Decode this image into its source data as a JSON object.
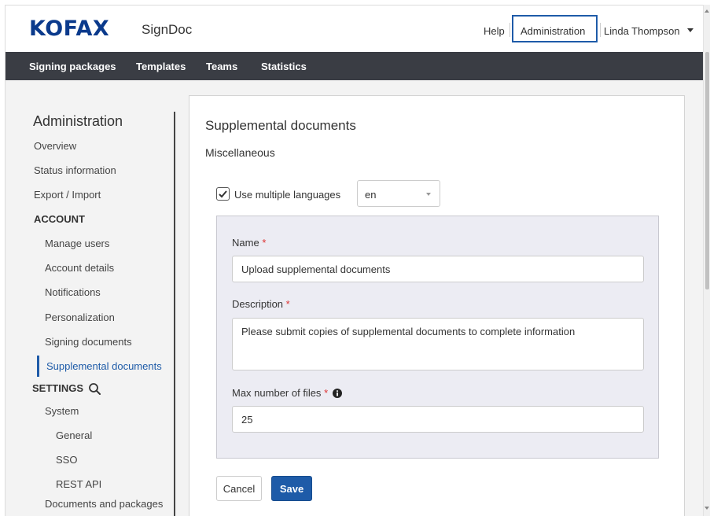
{
  "header": {
    "logo": "KOFAX",
    "product": "SignDoc",
    "help": "Help",
    "administration": "Administration",
    "user": "Linda Thompson"
  },
  "nav": {
    "items": [
      "Signing packages",
      "Templates",
      "Teams",
      "Statistics"
    ]
  },
  "sidebar": {
    "title": "Administration",
    "items": [
      "Overview",
      "Status information",
      "Export / Import",
      "ACCOUNT",
      "Manage users",
      "Account details",
      "Notifications",
      "Personalization",
      "Signing documents",
      "Supplemental documents",
      "SETTINGS",
      "System",
      "General",
      "SSO",
      "REST API",
      "Documents and packages"
    ],
    "active_item": "Supplemental documents"
  },
  "main": {
    "title": "Supplemental documents",
    "section": "Miscellaneous",
    "use_multiple_languages": {
      "label": "Use multiple languages",
      "checked": true
    },
    "language_select": "en",
    "form": {
      "name_label": "Name",
      "name_value": "Upload supplemental documents",
      "description_label": "Description",
      "description_value": "Please submit copies of supplemental documents to complete information",
      "max_files_label": "Max number of files",
      "max_files_value": "25",
      "required_marker": "*"
    },
    "buttons": {
      "cancel": "Cancel",
      "save": "Save"
    }
  },
  "colors": {
    "brand": "#0b3a8c",
    "accent": "#1e5ba8",
    "nav_bg": "#3a3d44",
    "required": "#dd3333"
  },
  "icons": {
    "search": "search-icon",
    "info": "info-icon",
    "checkbox": "check-icon"
  }
}
